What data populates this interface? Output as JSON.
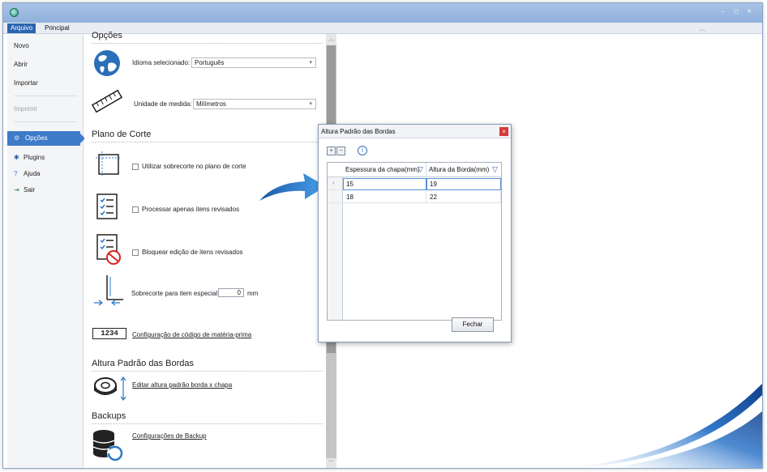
{
  "window": {
    "ribbon_tabs": [
      "Arquivo",
      "Principal"
    ]
  },
  "nav": {
    "items": [
      {
        "label": "Novo",
        "icon": ""
      },
      {
        "label": "Abrir",
        "icon": ""
      },
      {
        "label": "Importar",
        "icon": ""
      },
      {
        "label": "Imprimir",
        "icon": "",
        "disabled": true
      },
      {
        "label": "Opções",
        "icon": "gear-icon",
        "selected": true
      },
      {
        "label": "Plugins",
        "icon": "puzzle-icon"
      },
      {
        "label": "Ajuda",
        "icon": "help-icon"
      },
      {
        "label": "Sair",
        "icon": "exit-icon"
      }
    ]
  },
  "options": {
    "section_title": "Opções",
    "language_label": "Idioma selecionado:",
    "language_value": "Português",
    "unit_label": "Unidade de medida:",
    "unit_value": "Milímetros"
  },
  "cutting_plan": {
    "section_title": "Plano de Corte",
    "overcut_label": "Utilizar sobrecorte no plano de corte",
    "process_reviewed_label": "Processar apenas itens revisados",
    "block_edit_label": "Bloquear edição de itens revisados",
    "special_overcut_label": "Sobrecorte para item especial",
    "special_overcut_value": "0",
    "special_overcut_unit": "mm",
    "code_icon_text": "1234",
    "code_config_link": "Configuração de código de matéria-prima"
  },
  "edge_height": {
    "section_title": "Altura Padrão das Bordas",
    "edit_link": "Editar altura padrão borda x chapa"
  },
  "backups": {
    "section_title": "Backups",
    "config_link": "Configurações de Backup"
  },
  "dialog": {
    "title": "Altura Padrão das Bordas",
    "columns": [
      "Espessura da chapa(mm)",
      "Altura da Borda(mm)"
    ],
    "rows": [
      {
        "thickness": "15",
        "height": "19"
      },
      {
        "thickness": "18",
        "height": "22"
      }
    ],
    "close_button": "Fechar"
  },
  "colors": {
    "accent": "#3e7bc9",
    "titlebar": "#9db9e0"
  }
}
